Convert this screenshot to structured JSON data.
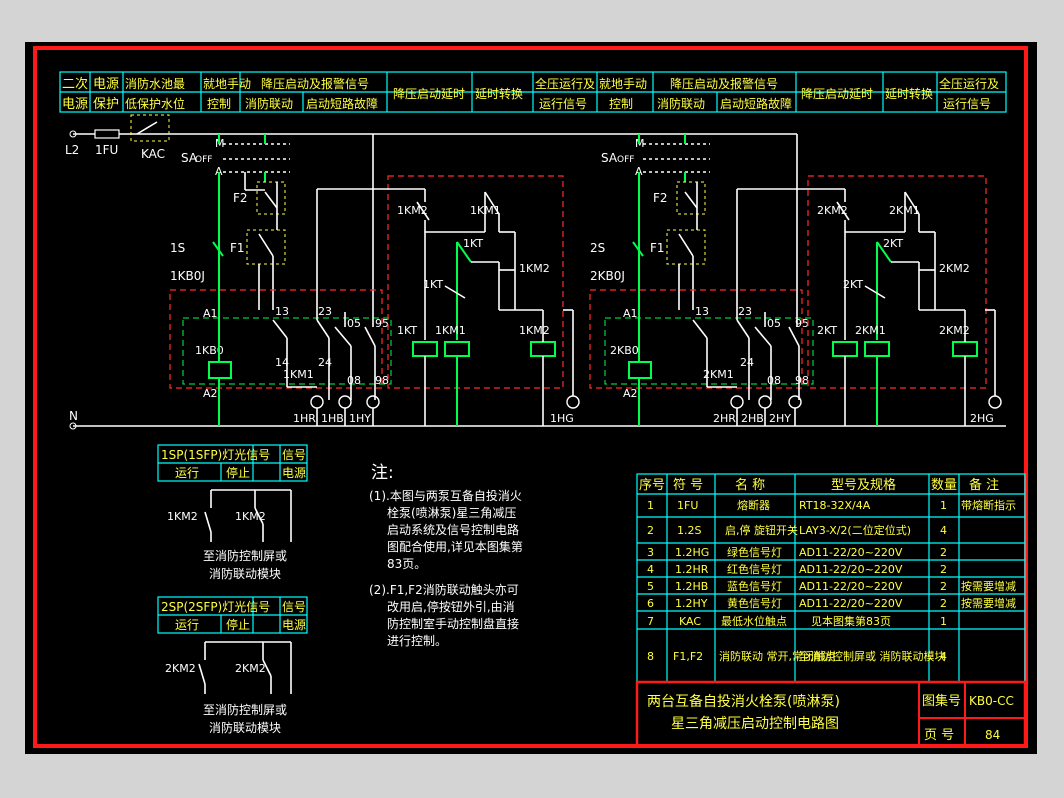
{
  "header_row1": [
    "二次",
    "电源",
    "消防水池",
    "最低",
    "就地手动",
    "降压启动及报警信号",
    "",
    "降压启动延时",
    "延时转换",
    "全压运行及",
    "就地手动",
    "降压启动及报警信号",
    "",
    "降压启动延时",
    "延时转换",
    "全压运行及"
  ],
  "header_row2": [
    "电源",
    "保护",
    "低保护",
    "水位",
    "控制",
    "消防联动",
    "启动短路故障",
    "",
    "",
    "运行信号",
    "控制",
    "消防联动",
    "启动短路故障",
    "",
    "",
    "运行信号"
  ],
  "header": {
    "c1a": "二次",
    "c1b": "电源",
    "c2a": "电源",
    "c2b": "保护",
    "c3a": "消防水池最",
    "c3b": "低保护水位",
    "c4a": "就地手动",
    "c4b": "控制",
    "c5a": "降压启动及报警信号",
    "c5b1": "消防联动",
    "c5b2": "启动短路故障",
    "c6": "降压启动延时",
    "c7": "延时转换",
    "c8a": "全压运行及",
    "c8b": "运行信号",
    "c9a": "就地手动",
    "c9b": "控制",
    "c10a": "降压启动及报警信号",
    "c10b1": "消防联动",
    "c10b2": "启动短路故障",
    "c11": "降压启动延时",
    "c12": "延时转换",
    "c13a": "全压运行及",
    "c13b": "运行信号"
  },
  "labels": {
    "L2": "L2",
    "FU1": "1FU",
    "KAC": "KAC",
    "N": "N",
    "SA_left": "SA",
    "SA_right": "SA",
    "M": "M",
    "OFF": "OFF",
    "A": "A",
    "F2": "F2",
    "F1": "F1",
    "S1": "1S",
    "S2": "2S",
    "KB0J1": "1KB0J",
    "KB0J2": "2KB0J",
    "A1": "A1",
    "A2": "A2",
    "KB01": "1KB0",
    "KB02": "2KB0",
    "t13": "13",
    "t14": "14",
    "t23": "23",
    "t24": "24",
    "t05": "05",
    "t08": "08",
    "t95": "95",
    "t98": "98",
    "KM1_1": "1KM1",
    "KM1_2": "2KM1",
    "HR1": "1HR",
    "HB1": "1HB",
    "HY1": "1HY",
    "HG1": "1HG",
    "HR2": "2HR",
    "HB2": "2HB",
    "HY2": "2HY",
    "HG2": "2HG",
    "KM2a1": "1KM2",
    "KM1a1": "1KM1",
    "KT1": "1KT",
    "KTc1": "1KT",
    "KMb1": "1KM2",
    "KTcoil1": "1KT",
    "KMcoil1": "1KM1",
    "KM2coil1": "1KM2",
    "KM2a2": "2KM2",
    "KM1a2": "2KM1",
    "KT2": "2KT",
    "KTc2": "2KT",
    "KMb2": "2KM2",
    "KTcoil2": "2KT",
    "KMcoil2": "2KM1",
    "KM2coil2": "2KM2"
  },
  "signal1": {
    "title": "1SP(1SFP)灯光信号",
    "sub_run": "运行",
    "sub_stop": "停止",
    "sig_a": "信号",
    "sig_b": "电源",
    "km2": "1KM2",
    "km2b": "1KM2",
    "dest_a": "至消防控制屏或",
    "dest_b": "消防联动模块"
  },
  "signal2": {
    "title": "2SP(2SFP)灯光信号",
    "sub_run": "运行",
    "sub_stop": "停止",
    "sig_a": "信号",
    "sig_b": "电源",
    "km2": "2KM2",
    "km2b": "2KM2",
    "dest_a": "至消防控制屏或",
    "dest_b": "消防联动模块"
  },
  "notes": {
    "title": "注:",
    "n1": [
      "(1).本图与两泵互备自投消火",
      "栓泵(喷淋泵)星三角减压",
      "启动系统及信号控制电路",
      "图配合使用,详见本图集第",
      "83页。"
    ],
    "n2": [
      "(2).F1,F2消防联动触头亦可",
      "改用启,停按钮外引,由消",
      "防控制室手动控制盘直接",
      "进行控制。"
    ]
  },
  "parts_table": {
    "headers": [
      "序号",
      "符 号",
      "名 称",
      "型号及规格",
      "数量",
      "备 注"
    ],
    "rows": [
      [
        "1",
        "1FU",
        "熔断器",
        "RT18-32X/4A",
        "1",
        "带熔断指示"
      ],
      [
        "2",
        "1.2S",
        "启,停 旋钮开关",
        "LAY3-X/2(二位定位式)",
        "4",
        ""
      ],
      [
        "3",
        "1.2HG",
        "绿色信号灯",
        "AD11-22/20~220V",
        "2",
        ""
      ],
      [
        "4",
        "1.2HR",
        "红色信号灯",
        "AD11-22/20~220V",
        "2",
        ""
      ],
      [
        "5",
        "1.2HB",
        "蓝色信号灯",
        "AD11-22/20~220V",
        "2",
        "按需要增减"
      ],
      [
        "6",
        "1.2HY",
        "黄色信号灯",
        "AD11-22/20~220V",
        "2",
        "按需要增减"
      ],
      [
        "7",
        "KAC",
        "最低水位触点",
        "见本图集第83页",
        "1",
        ""
      ],
      [
        "8",
        "F1,F2",
        "消防联动 常开,常闭触点",
        "至消防控制屏或 消防联动模块",
        "4",
        ""
      ]
    ]
  },
  "title_block": {
    "title_a": "两台互备自投消火栓泵(喷淋泵)",
    "title_b": "星三角减压启动控制电路图",
    "atlas_label": "图集号",
    "atlas_value": "KB0-CC",
    "page_label": "页 号",
    "page_value": "84"
  },
  "colors": {
    "background": "#000000",
    "frame": "#ff1a1a",
    "wire": "#ffffff",
    "live": "#00ff4c",
    "text": "#ffff40",
    "table": "#00ffff"
  }
}
